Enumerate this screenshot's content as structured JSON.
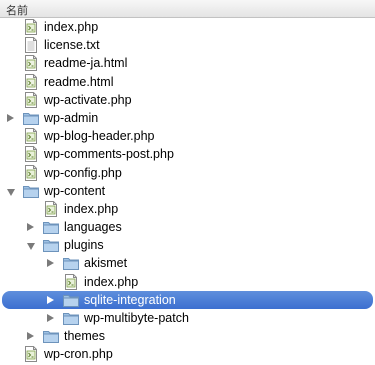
{
  "header": {
    "column_label": "名前"
  },
  "items": [
    {
      "name": "index.php",
      "type": "php",
      "level": 1,
      "expander": "none",
      "selected": false
    },
    {
      "name": "license.txt",
      "type": "txt",
      "level": 1,
      "expander": "none",
      "selected": false
    },
    {
      "name": "readme-ja.html",
      "type": "html",
      "level": 1,
      "expander": "none",
      "selected": false
    },
    {
      "name": "readme.html",
      "type": "html",
      "level": 1,
      "expander": "none",
      "selected": false
    },
    {
      "name": "wp-activate.php",
      "type": "php",
      "level": 1,
      "expander": "none",
      "selected": false
    },
    {
      "name": "wp-admin",
      "type": "folder",
      "level": 1,
      "expander": "closed",
      "selected": false
    },
    {
      "name": "wp-blog-header.php",
      "type": "php",
      "level": 1,
      "expander": "none",
      "selected": false
    },
    {
      "name": "wp-comments-post.php",
      "type": "php",
      "level": 1,
      "expander": "none",
      "selected": false
    },
    {
      "name": "wp-config.php",
      "type": "php",
      "level": 1,
      "expander": "none",
      "selected": false
    },
    {
      "name": "wp-content",
      "type": "folder",
      "level": 1,
      "expander": "open",
      "selected": false
    },
    {
      "name": "index.php",
      "type": "php",
      "level": 2,
      "expander": "none",
      "selected": false
    },
    {
      "name": "languages",
      "type": "folder",
      "level": 2,
      "expander": "closed",
      "selected": false
    },
    {
      "name": "plugins",
      "type": "folder",
      "level": 2,
      "expander": "open",
      "selected": false
    },
    {
      "name": "akismet",
      "type": "folder",
      "level": 3,
      "expander": "closed",
      "selected": false
    },
    {
      "name": "index.php",
      "type": "php",
      "level": 3,
      "expander": "none",
      "selected": false
    },
    {
      "name": "sqlite-integration",
      "type": "folder",
      "level": 3,
      "expander": "closed",
      "selected": true
    },
    {
      "name": "wp-multibyte-patch",
      "type": "folder",
      "level": 3,
      "expander": "closed",
      "selected": false
    },
    {
      "name": "themes",
      "type": "folder",
      "level": 2,
      "expander": "closed",
      "selected": false
    },
    {
      "name": "wp-cron.php",
      "type": "php",
      "level": 1,
      "expander": "none",
      "selected": false
    }
  ],
  "colors": {
    "selection": "#3c6fd0",
    "folder": "#8fb4d9",
    "expander": "#7a7a7a"
  }
}
